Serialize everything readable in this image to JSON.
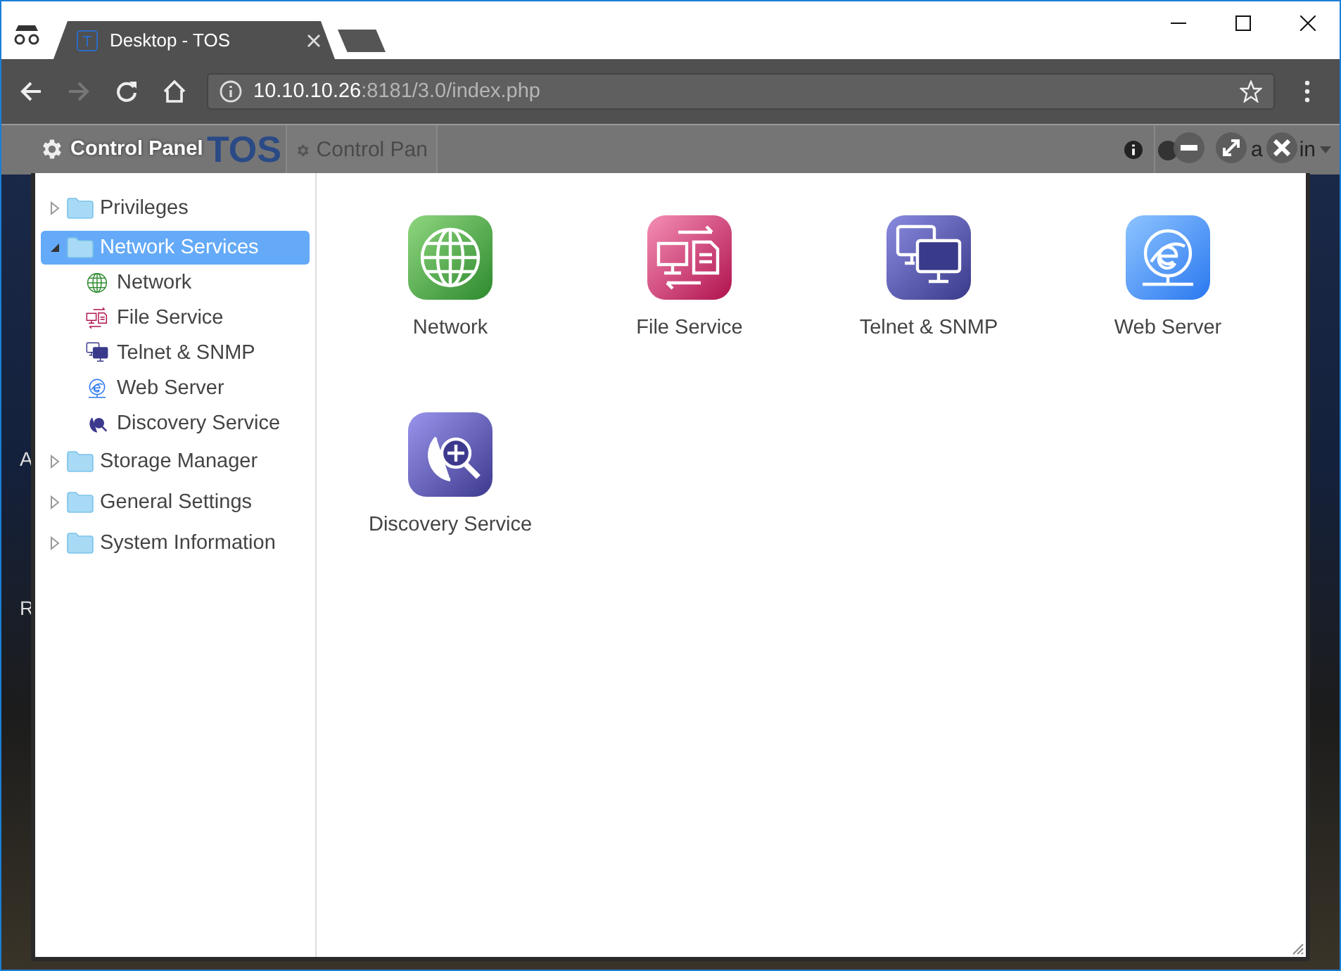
{
  "browser": {
    "tab_title": "Desktop - TOS",
    "url_host": "10.10.10.26",
    "url_path": ":8181/3.0/index.php"
  },
  "desktop": {
    "logo": "TOS",
    "taskbar_item": "Control Pan",
    "user_head": "a",
    "user_tail": "in",
    "icons": [
      "A",
      "R"
    ]
  },
  "window": {
    "title": "Control Panel"
  },
  "sidebar": {
    "items": [
      {
        "label": "Privileges",
        "expanded": false,
        "selected": false
      },
      {
        "label": "Network Services",
        "expanded": true,
        "selected": true,
        "children": [
          {
            "label": "Network",
            "kind": "network",
            "selected": false
          },
          {
            "label": "File Service",
            "kind": "file",
            "selected": false
          },
          {
            "label": "Telnet & SNMP",
            "kind": "telnet",
            "selected": false
          },
          {
            "label": "Web Server",
            "kind": "web",
            "selected": false
          },
          {
            "label": "Discovery Service",
            "kind": "discovery",
            "selected": false
          }
        ]
      },
      {
        "label": "Storage Manager",
        "expanded": false,
        "selected": false
      },
      {
        "label": "General Settings",
        "expanded": false,
        "selected": false
      },
      {
        "label": "System Information",
        "expanded": false,
        "selected": false
      }
    ]
  },
  "apps": [
    {
      "label": "Network",
      "kind": "network"
    },
    {
      "label": "File Service",
      "kind": "file"
    },
    {
      "label": "Telnet & SNMP",
      "kind": "telnet"
    },
    {
      "label": "Web Server",
      "kind": "web"
    },
    {
      "label": "Discovery Service",
      "kind": "discovery"
    }
  ]
}
